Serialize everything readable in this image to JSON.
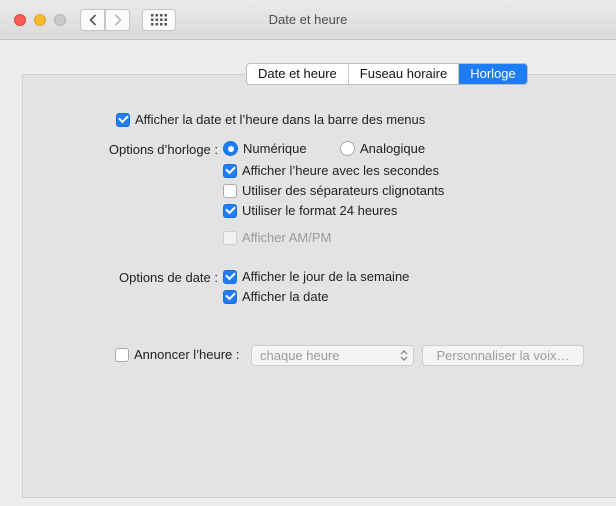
{
  "window": {
    "title": "Date et heure"
  },
  "toolbar": {
    "back_icon": "chevron-left-icon",
    "forward_icon": "chevron-right-icon",
    "grid_icon": "grid-icon"
  },
  "tabs": [
    {
      "label": "Date et heure",
      "active": false
    },
    {
      "label": "Fuseau horaire",
      "active": false
    },
    {
      "label": "Horloge",
      "active": true
    }
  ],
  "clock": {
    "show_in_menubar": {
      "label": "Afficher la date et l’heure dans la barre des menus",
      "checked": true
    },
    "options_label": "Options d’horloge :",
    "digital": {
      "label": "Numérique",
      "selected": true
    },
    "analog": {
      "label": "Analogique",
      "selected": false
    },
    "show_seconds": {
      "label": "Afficher l’heure avec les secondes",
      "checked": true
    },
    "flash_separators": {
      "label": "Utiliser des séparateurs clignotants",
      "checked": false
    },
    "use_24h": {
      "label": "Utiliser le format 24 heures",
      "checked": true
    },
    "show_ampm": {
      "label": "Afficher AM/PM",
      "checked": false,
      "enabled": false
    }
  },
  "date": {
    "options_label": "Options de date :",
    "show_weekday": {
      "label": "Afficher le jour de la semaine",
      "checked": true
    },
    "show_date": {
      "label": "Afficher la date",
      "checked": true
    }
  },
  "announce": {
    "label": "Annoncer l’heure :",
    "checked": false,
    "interval": "chaque heure",
    "customize_label": "Personnaliser la voix…"
  },
  "colors": {
    "accent": "#1f7cf5",
    "panel": "#e3e3e3",
    "window": "#ececec"
  }
}
